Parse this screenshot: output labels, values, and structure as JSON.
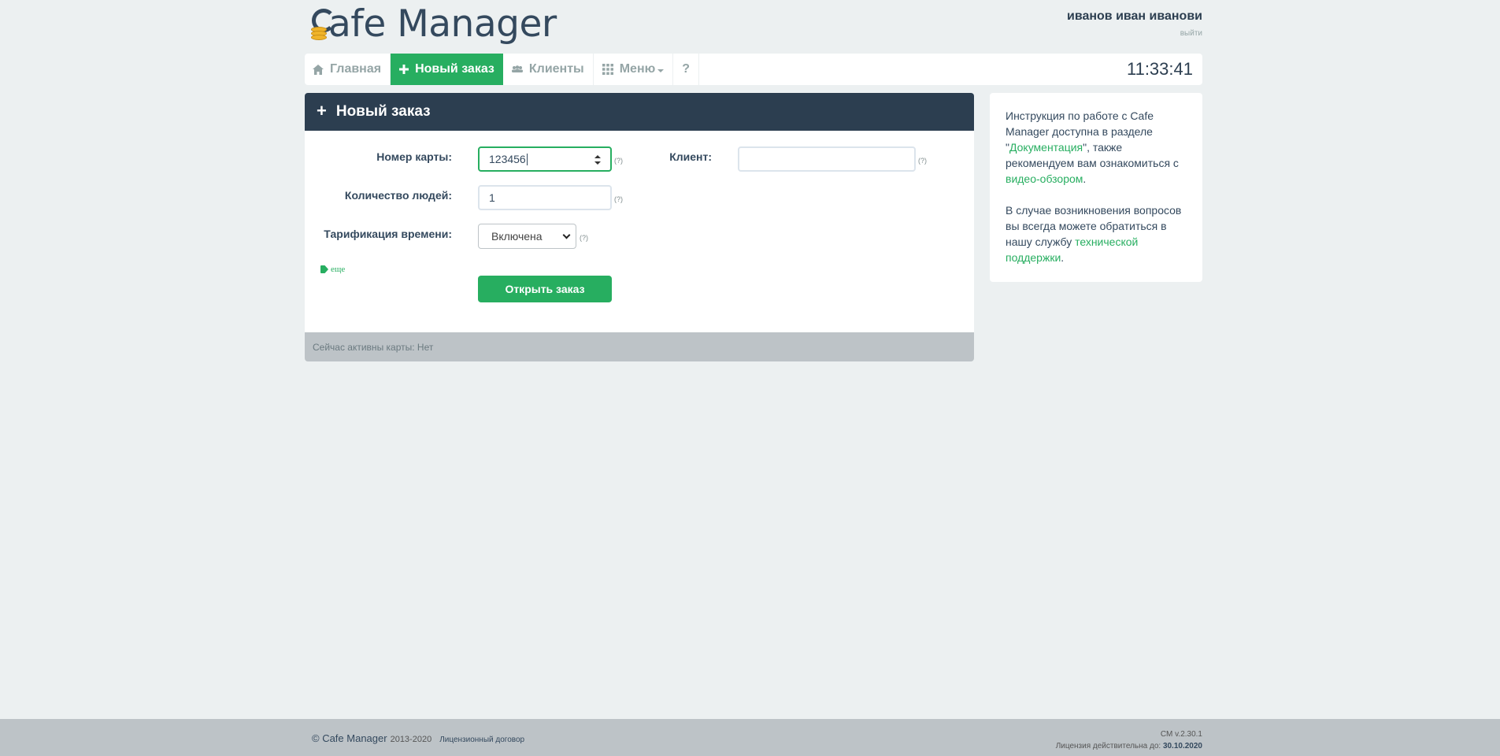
{
  "header": {
    "logo_text": "afe Manager",
    "user_name": "иванов иван иванови",
    "logout": "выйти"
  },
  "nav": {
    "items": [
      {
        "label": "Главная",
        "icon": "home-icon"
      },
      {
        "label": "Новый заказ",
        "icon": "plus-icon",
        "active": true
      },
      {
        "label": "Клиенты",
        "icon": "users-icon"
      },
      {
        "label": "Меню",
        "icon": "grid-icon"
      },
      {
        "label": "?",
        "icon": ""
      }
    ],
    "clock": "11:33:41"
  },
  "panel": {
    "title": "Новый заказ",
    "card_label": "Номер карты:",
    "card_value": "123456",
    "client_label": "Клиент:",
    "client_value": "",
    "people_label": "Количество людей:",
    "people_value": "1",
    "tariff_label": "Тарификация времени:",
    "tariff_value": "Включена",
    "hint": "(?)",
    "more": "еще",
    "open_button": "Открыть заказ",
    "footer": "Сейчас активны карты: Нет"
  },
  "side": {
    "p1_a": "Инструкция по работе с Cafe Manager доступна в разделе \"",
    "p1_link1": "Документация",
    "p1_b": "\", также рекомендуем вам ознакомиться с ",
    "p1_link2": "видео-обзором",
    "p1_c": ".",
    "p2_a": "В случае возникновения вопросов вы всегда можете обратиться в нашу службу ",
    "p2_link": "технической поддержки",
    "p2_b": "."
  },
  "footer": {
    "copyright": "© Cafe Manager",
    "years": "2013-2020",
    "license_link": "Лицензионный договор",
    "version": "CM v.2.30.1",
    "license_label": "Лицензия действительна до:",
    "license_date": "30.10.2020"
  },
  "colors": {
    "accent": "#27ae60",
    "dark": "#2c3e50",
    "background": "#ecf0f1"
  }
}
